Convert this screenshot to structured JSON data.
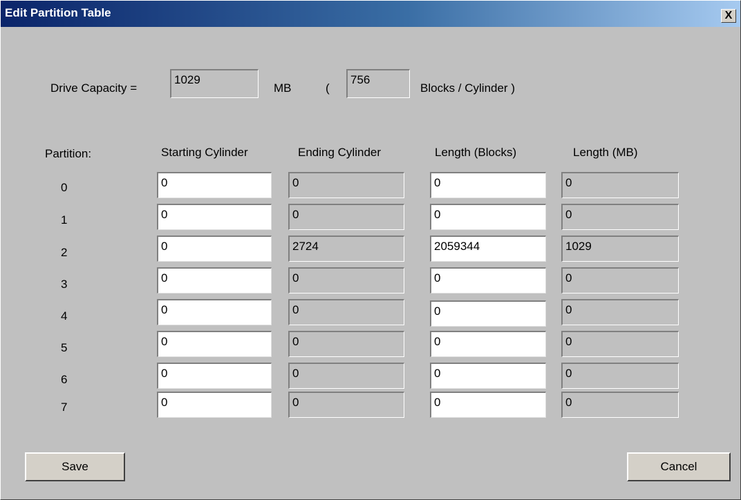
{
  "window": {
    "title": "Edit Partition Table",
    "close_label": "X"
  },
  "capacity": {
    "label": "Drive Capacity =",
    "mb_value": "1029",
    "mb_unit": "MB",
    "open_paren": "(",
    "blocks_value": "756",
    "blocks_unit": "Blocks / Cylinder )"
  },
  "headers": {
    "partition": "Partition:",
    "starting_cylinder": "Starting Cylinder",
    "ending_cylinder": "Ending Cylinder",
    "length_blocks": "Length (Blocks)",
    "length_mb": "Length (MB)"
  },
  "rows": [
    {
      "partition": "0",
      "start": "0",
      "end": "0",
      "blocks": "0",
      "mb": "0"
    },
    {
      "partition": "1",
      "start": "0",
      "end": "0",
      "blocks": "0",
      "mb": "0"
    },
    {
      "partition": "2",
      "start": "0",
      "end": "2724",
      "blocks": "2059344",
      "mb": "1029"
    },
    {
      "partition": "3",
      "start": "0",
      "end": "0",
      "blocks": "0",
      "mb": "0"
    },
    {
      "partition": "4",
      "start": "0",
      "end": "0",
      "blocks": "0",
      "mb": "0"
    },
    {
      "partition": "5",
      "start": "0",
      "end": "0",
      "blocks": "0",
      "mb": "0"
    },
    {
      "partition": "6",
      "start": "0",
      "end": "0",
      "blocks": "0",
      "mb": "0"
    },
    {
      "partition": "7",
      "start": "0",
      "end": "0",
      "blocks": "0",
      "mb": "0"
    }
  ],
  "buttons": {
    "save": "Save",
    "cancel": "Cancel"
  }
}
